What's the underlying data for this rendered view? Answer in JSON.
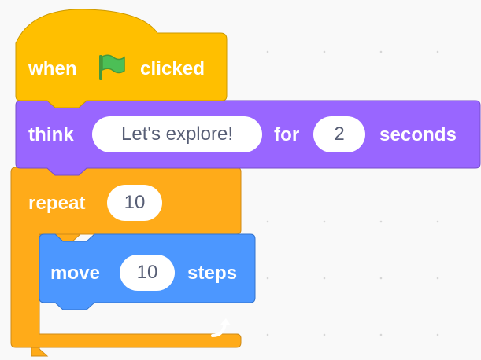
{
  "script": {
    "when_flag_block": {
      "before_flag": "when",
      "after_flag": "clicked",
      "flag_icon": "green-flag-icon"
    },
    "think_block": {
      "label": "think",
      "message": "Let's explore!",
      "for_label": "for",
      "duration": "2",
      "unit_label": "seconds"
    },
    "repeat_block": {
      "label": "repeat",
      "times": "10",
      "loop_icon": "loop-arrow-icon"
    },
    "move_block": {
      "label": "move",
      "steps": "10",
      "unit_label": "steps"
    }
  },
  "colors": {
    "events": "#ffbf00",
    "looks": "#9966ff",
    "control": "#ffab19",
    "motion": "#4c97ff",
    "flag": "#4cbf56",
    "input_text": "#575e75",
    "workspace": "#f9f9f9"
  }
}
